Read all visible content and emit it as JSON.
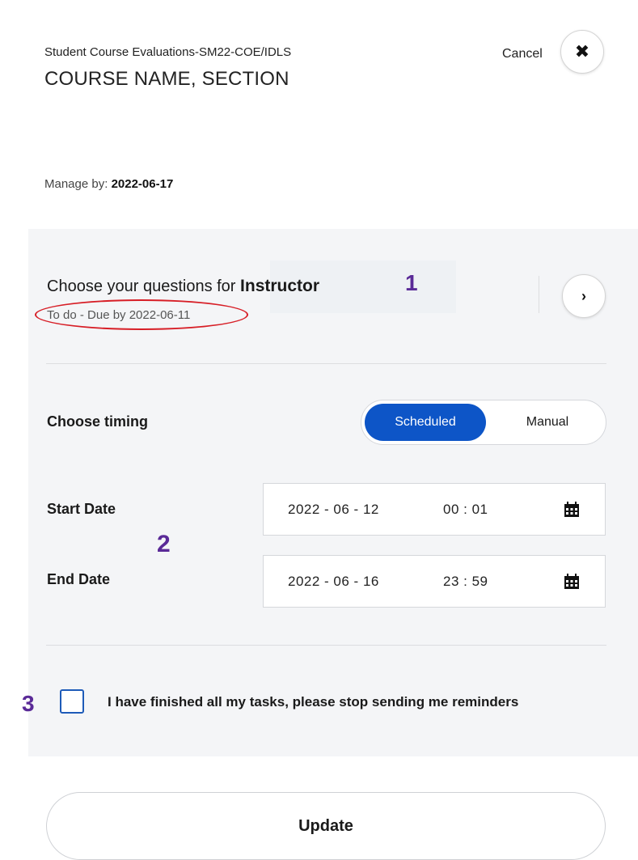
{
  "header": {
    "subtitle": "Student Course Evaluations-SM22-COE/IDLS",
    "title": "COURSE NAME, SECTION",
    "cancel_label": "Cancel",
    "close_icon": "close-icon"
  },
  "manage": {
    "label": "Manage by:",
    "date": "2022-06-17"
  },
  "questions": {
    "prefix": "Choose your questions for",
    "role": "Instructor",
    "status": "To do - Due by 2022-06-11",
    "status_icon": "hourglass-icon",
    "next_icon": "chevron-right-icon"
  },
  "timing": {
    "label": "Choose timing",
    "options": [
      "Scheduled",
      "Manual"
    ],
    "selected": "Scheduled",
    "accent_color": "#0d55c7"
  },
  "start": {
    "label": "Start Date",
    "date": "2022 - 06 - 12",
    "time": "00 : 01"
  },
  "end": {
    "label": "End Date",
    "date": "2022 - 06 - 16",
    "time": "23 : 59"
  },
  "reminder": {
    "label": "I have finished all my tasks, please stop sending me reminders",
    "checked": false
  },
  "annotations": {
    "one": "1",
    "two": "2",
    "three": "3",
    "color": "#5a2a97",
    "highlight_color": "#d71e26"
  },
  "update_label": "Update"
}
